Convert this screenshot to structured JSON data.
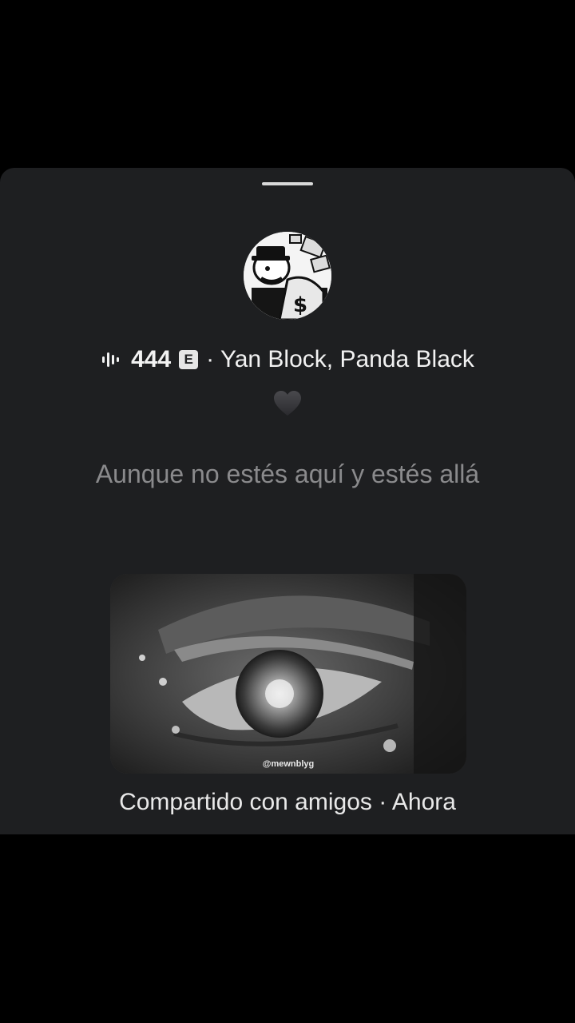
{
  "story": {
    "track_title": "444",
    "explicit_label": "E",
    "artists": "· Yan Block, Panda Black",
    "lyric": "Aunque no estés aquí y estés allá",
    "media_watermark": "@mewnblyg",
    "caption": "Compartido con amigos · Ahora"
  },
  "icons": {
    "now_playing": "audio-bars-icon",
    "explicit": "explicit-icon",
    "heart": "black-heart-icon"
  },
  "colors": {
    "background": "#000000",
    "sheet": "#1e1f21",
    "text_primary": "#f2f2f2",
    "text_secondary": "#8a8a8c"
  }
}
